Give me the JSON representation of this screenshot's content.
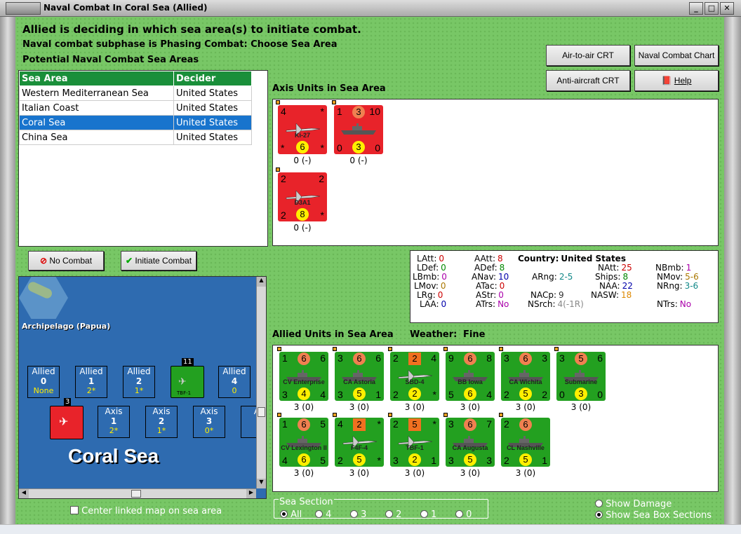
{
  "window": {
    "title": "Naval Combat In Coral Sea (Allied)"
  },
  "header": {
    "line1": "Allied is deciding in which sea area(s) to initiate combat.",
    "line2": "Naval combat subphase is Phasing Combat: Choose Sea Area",
    "line3": "Potential Naval Combat Sea Areas"
  },
  "buttons": {
    "air_to_air": "Air-to-air CRT",
    "naval_chart": "Naval Combat Chart",
    "anti_aircraft": "Anti-aircraft CRT",
    "help": "Help",
    "no_combat": "No Combat",
    "initiate": "Initiate Combat"
  },
  "table": {
    "col1": "Sea Area",
    "col2": "Decider",
    "rows": [
      {
        "area": "Western Mediterranean Sea",
        "decider": "United States"
      },
      {
        "area": "Italian Coast",
        "decider": "United States"
      },
      {
        "area": "Coral Sea",
        "decider": "United States"
      },
      {
        "area": "China Sea",
        "decider": "United States"
      }
    ]
  },
  "axis": {
    "title": "Axis Units in Sea Area",
    "units": [
      {
        "name": "Ki-27",
        "tl": "4",
        "tr": "*",
        "bl": "*",
        "br": "*",
        "c": "6",
        "under": "0 (-)"
      },
      {
        "name": "",
        "tl": "1",
        "tm": "3",
        "tr": "10",
        "bl": "0",
        "c": "3",
        "br": "0",
        "under": "0 (-)"
      },
      {
        "name": "D3A1",
        "tl": "2",
        "tr": "2",
        "bl": "2",
        "br": "*",
        "c": "8",
        "under": "0 (-)"
      }
    ]
  },
  "stats": {
    "latt_l": "LAtt:",
    "latt": "0",
    "ldef_l": "LDef:",
    "ldef": "0",
    "lbmb_l": "LBmb:",
    "lbmb": "0",
    "lmov_l": "LMov:",
    "lmov": "0",
    "lrng_l": "LRg:",
    "lrng": "0",
    "laa_l": "LAA:",
    "laa": "0",
    "aatt_l": "AAtt:",
    "aatt": "8",
    "adef_l": "ADef:",
    "adef": "8",
    "anav_l": "ANav:",
    "anav": "10",
    "atac_l": "ATac:",
    "atac": "0",
    "astr_l": "AStr:",
    "astr": "0",
    "atrs_l": "ATrs:",
    "atrs": "No",
    "country_l": "Country:",
    "country": "United States",
    "arng_l": "ARng:",
    "arng": "2-5",
    "nacp_l": "NACp:",
    "nacp": "9",
    "nsrch_l": "NSrch:",
    "nsrch": "4(-1R)",
    "natt_l": "NAtt:",
    "natt": "25",
    "ships_l": "Ships:",
    "ships": "8",
    "naa_l": "NAA:",
    "naa": "22",
    "nasw_l": "NASW:",
    "nasw": "18",
    "nbmb_l": "NBmb:",
    "nbmb": "1",
    "nmov_l": "NMov:",
    "nmov": "5-6",
    "nrng_l": "NRng:",
    "nrng": "3-6",
    "ntrs_l": "NTrs:",
    "ntrs": "No"
  },
  "allied": {
    "title": "Allied Units in Sea Area",
    "weather_l": "Weather:",
    "weather": "Fine",
    "units": [
      {
        "name": "CV Enterprise",
        "tl": "1",
        "tm": "6",
        "tr": "6",
        "bl": "3",
        "c": "4",
        "br": "4",
        "under": "3 (0)"
      },
      {
        "name": "CA Astoria",
        "tl": "3",
        "tm": "6",
        "tr": "6",
        "bl": "3",
        "c": "5",
        "br": "1",
        "under": "3 (0)"
      },
      {
        "name": "SBD-4",
        "tl": "2",
        "tm": "2",
        "tr": "4",
        "bl": "2",
        "c": "2",
        "br": "*",
        "under": "3 (0)"
      },
      {
        "name": "BB Iowa",
        "tl": "9",
        "tm": "6",
        "tr": "8",
        "bl": "5",
        "c": "6",
        "br": "4",
        "under": "3 (0)"
      },
      {
        "name": "CA Wichita",
        "tl": "3",
        "tm": "6",
        "tr": "3",
        "bl": "2",
        "c": "5",
        "br": "2",
        "under": "3 (0)"
      },
      {
        "name": "Submarine",
        "tl": "3",
        "tm": "5",
        "tr": "6",
        "bl": "0",
        "c": "3",
        "br": "0",
        "under": "3 (0)"
      },
      {
        "name": "CV Lexington II",
        "tl": "1",
        "tm": "6",
        "tr": "5",
        "bl": "4",
        "c": "6",
        "br": "5",
        "under": "3 (0)"
      },
      {
        "name": "F4F-4",
        "tl": "4",
        "tm": "2",
        "tr": "*",
        "bl": "2",
        "c": "5",
        "br": "*",
        "under": "3 (0)"
      },
      {
        "name": "TBF-1",
        "tl": "2",
        "tm": "5",
        "tr": "*",
        "bl": "3",
        "c": "2",
        "br": "1",
        "under": "3 (0)"
      },
      {
        "name": "CA Augusta",
        "tl": "3",
        "tm": "6",
        "tr": "7",
        "bl": "3",
        "c": "5",
        "br": "3",
        "under": "3 (0)"
      },
      {
        "name": "CL Nashville",
        "tl": "2",
        "tm": "6",
        "tr": "",
        "bl": "2",
        "c": "5",
        "br": "1",
        "under": "3 (0)"
      }
    ]
  },
  "map": {
    "region": "Archipelago (Papua)",
    "sea": "Coral Sea",
    "stack1": "11",
    "stack2": "3",
    "stack_name": "TBF-1",
    "allied": [
      {
        "l": "Allied",
        "n": "0",
        "s": "None"
      },
      {
        "l": "Allied",
        "n": "1",
        "s": "2*"
      },
      {
        "l": "Allied",
        "n": "2",
        "s": "1*"
      },
      {
        "l": "Allied",
        "n": "4",
        "s": "0"
      }
    ],
    "axis": [
      {
        "l": "Axis",
        "n": "1",
        "s": "2*"
      },
      {
        "l": "Axis",
        "n": "2",
        "s": "1*"
      },
      {
        "l": "Axis",
        "n": "3",
        "s": "0*"
      },
      {
        "l": "A",
        "n": "",
        "s": ""
      }
    ],
    "center_label": "Center linked map on sea area"
  },
  "sea_section": {
    "title": "Sea Section",
    "options": [
      "All",
      "4",
      "3",
      "2",
      "1",
      "0"
    ]
  },
  "options": {
    "show_damage": "Show Damage",
    "show_sections": "Show Sea Box Sections"
  },
  "colors": {
    "counter_red": "#e8232a",
    "counter_green": "#23a020",
    "selection": "#1874cd",
    "table_header": "#1a8f3a"
  }
}
